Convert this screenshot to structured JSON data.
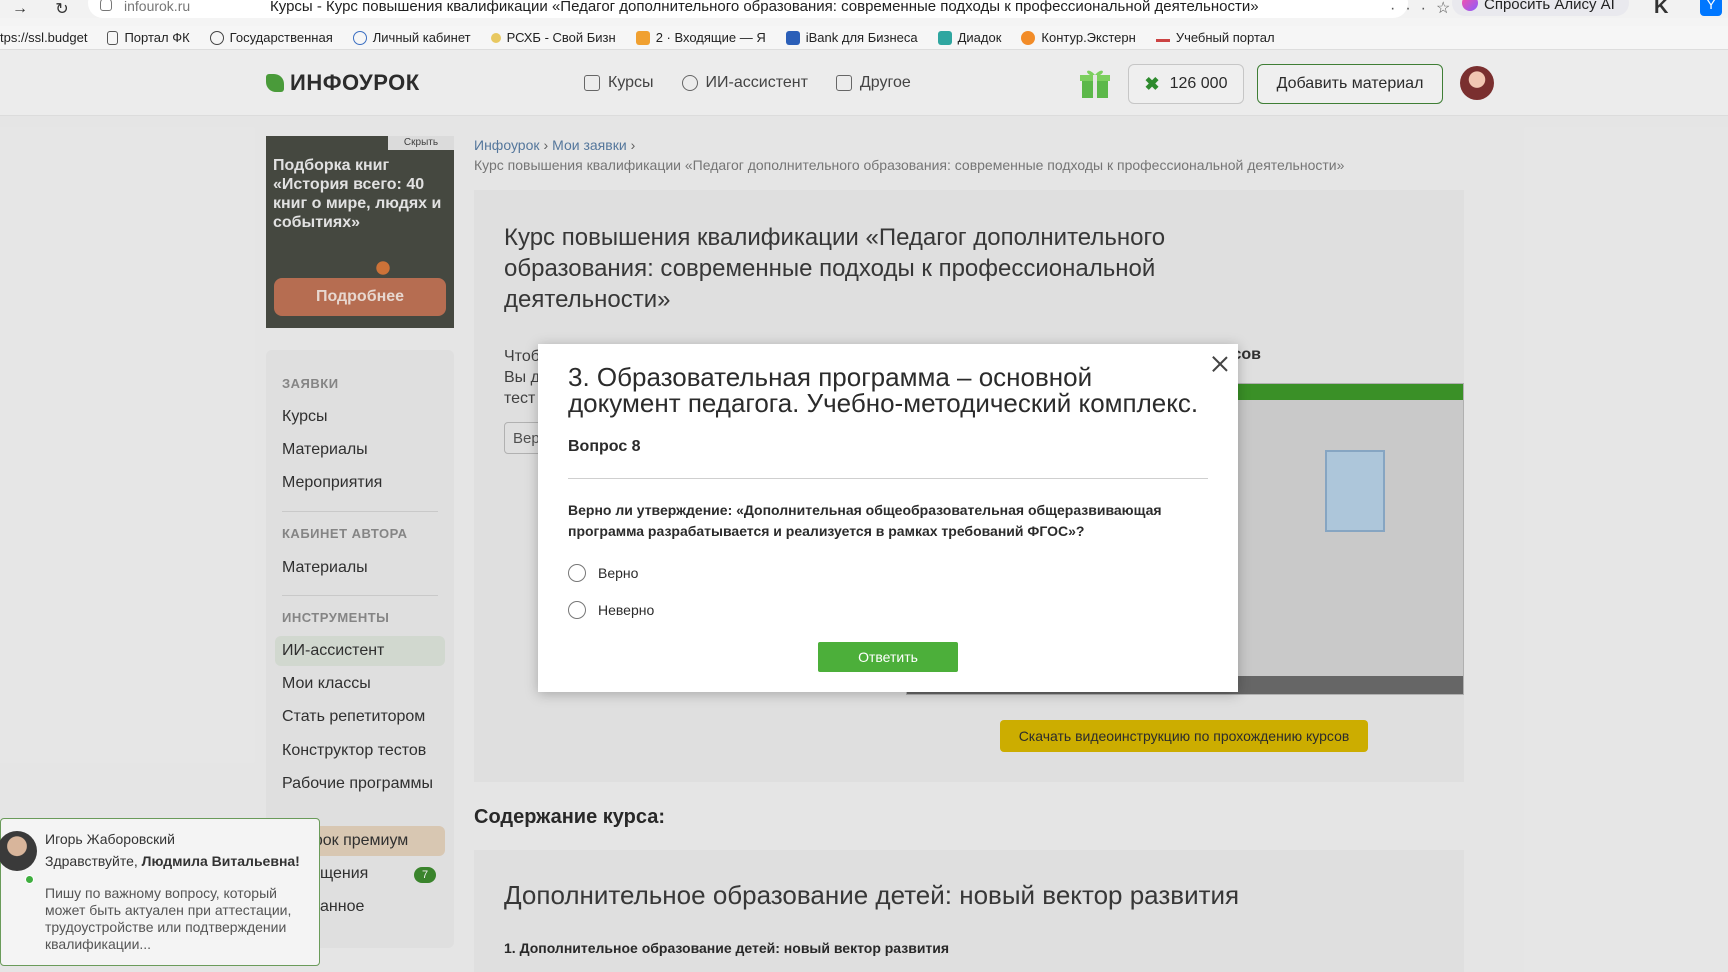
{
  "browser": {
    "url": "infourok.ru",
    "tab_title": "Курсы - Курс повышения квалификации «Педагог дополнительного образования: современные подходы к профессиональной деятельности»",
    "alice_label": "Спросить Алису AI",
    "bookmarks": [
      "tps://ssl.budget",
      "Портал ФК",
      "Государственная",
      "Личный кабинет",
      "РСХБ - Свой Бизн",
      "2 · Входящие — Я",
      "iBank для Бизнеса",
      "Диадок",
      "Контур.Экстерн",
      "Учебный портал"
    ]
  },
  "header": {
    "logo": "ИНФОУРОК",
    "nav": [
      "Курсы",
      "ИИ-ассистент",
      "Другое"
    ],
    "balance": "126 000",
    "add_material": "Добавить материал"
  },
  "promo": {
    "hide_label": "Скрыть",
    "title": "Подборка книг «История всего: 40 книг о мире, людях и событиях»",
    "button": "Подробнее"
  },
  "sidebar": {
    "section_requests": "ЗАЯВКИ",
    "courses": "Курсы",
    "materials": "Материалы",
    "events": "Мероприятия",
    "section_author": "КАБИНЕТ АВТОРА",
    "author_materials": "Материалы",
    "section_tools": "ИНСТРУМЕНТЫ",
    "ai_assistant": "ИИ-ассистент",
    "my_classes": "Мои классы",
    "become_tutor": "Стать репетитором",
    "test_builder": "Конструктор тестов",
    "work_programs": "Рабочие программы",
    "premium": "урок премиум",
    "messages": "щения",
    "messages_badge": "7",
    "favorites": "анное"
  },
  "breadcrumb": {
    "items": [
      "Инфоурок",
      "Мои заявки"
    ],
    "current": "Курс повышения квалификации «Педагог дополнительного образования: современные подходы к профессиональной деятельности»"
  },
  "main": {
    "course_title": "Курс повышения квалификации «Педагог дополнительного образования: современные подходы к профессиональной деятельности»",
    "intro_lines": [
      "Чтоб",
      "Вы д",
      "тест"
    ],
    "intro_button": "Вер",
    "video_heading": "урсов",
    "download_button": "Скачать видеоинструкцию по прохождению курсов",
    "content_heading": "Содержание курса:",
    "module_title": "Дополнительное образование детей: новый вектор развития",
    "module_sub": "1. Дополнительное образование детей: новый вектор развития"
  },
  "chat": {
    "name": "Игорь Жаборовский",
    "greeting_prefix": "Здравствуйте, ",
    "greeting_name": "Людмила Витальевна!",
    "message": "Пишу по важному вопросу, который может быть актуален при аттестации, трудоустройстве или подтверждении квалификации..."
  },
  "modal": {
    "title": "3. Образовательная программа – основной документ педагога. Учебно-методический комплекс.",
    "question_number": "Вопрос 8",
    "statement": "Верно ли утверждение: «Дополнительная общеобразовательная общеразвивающая программа разрабатывается и реализуется в рамках  требований ФГОС»?",
    "options": [
      "Верно",
      "Неверно"
    ],
    "submit": "Ответить"
  },
  "colors": {
    "accent_green": "#4caf3a",
    "brand_green": "#3f7e35",
    "download_yellow": "#d9b800",
    "link_blue": "#5b7fa6"
  }
}
